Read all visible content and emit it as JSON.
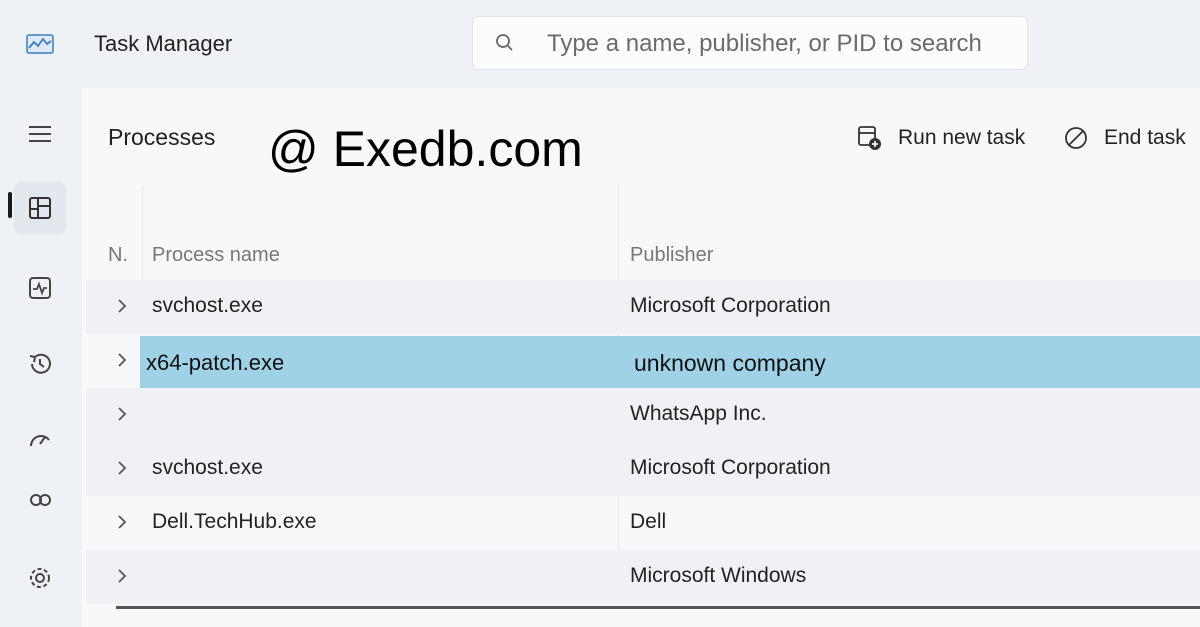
{
  "app": {
    "title": "Task Manager"
  },
  "search": {
    "placeholder": "Type a name, publisher, or PID to search"
  },
  "page": {
    "title": "Processes"
  },
  "watermark": "@ Exedb.com",
  "toolbar": {
    "run_new_task": "Run new task",
    "end_task": "End task"
  },
  "table": {
    "columns": {
      "n": "N.",
      "process_name": "Process name",
      "publisher": "Publisher"
    },
    "rows": [
      {
        "name": "svchost.exe",
        "publisher": "Microsoft Corporation"
      },
      {
        "name": "x64-patch.exe",
        "publisher": "unknown company"
      },
      {
        "name": "",
        "publisher": "WhatsApp Inc."
      },
      {
        "name": "svchost.exe",
        "publisher": "Microsoft Corporation"
      },
      {
        "name": "Dell.TechHub.exe",
        "publisher": "Dell"
      },
      {
        "name": "",
        "publisher": "Microsoft Windows"
      }
    ]
  },
  "colors": {
    "selected_row": "#9fd2e6",
    "background": "#eef1f5"
  }
}
